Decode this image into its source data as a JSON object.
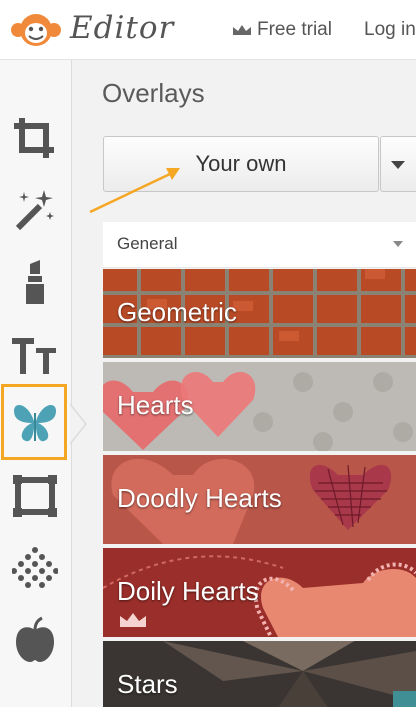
{
  "header": {
    "logo_text": "Editor",
    "free_trial_label": "Free trial",
    "login_label": "Log in"
  },
  "sidebar": {
    "tools": [
      {
        "icon": "crop-icon"
      },
      {
        "icon": "magic-wand-icon"
      },
      {
        "icon": "lipstick-icon"
      },
      {
        "icon": "text-icon"
      },
      {
        "icon": "butterfly-icon",
        "active": true
      },
      {
        "icon": "frame-icon"
      },
      {
        "icon": "texture-icon"
      },
      {
        "icon": "apple-icon"
      }
    ]
  },
  "panel": {
    "title": "Overlays",
    "dropdown_value": "Your own",
    "category_label": "General",
    "items": [
      {
        "name": "Geometric"
      },
      {
        "name": "Hearts"
      },
      {
        "name": "Doodly Hearts"
      },
      {
        "name": "Doily Hearts",
        "premium": true
      },
      {
        "name": "Stars"
      }
    ]
  },
  "colors": {
    "accent": "#f5a623",
    "sidebar_icon": "#555555",
    "active_icon": "#4da3b5",
    "logo_orange": "#f08a3a"
  }
}
